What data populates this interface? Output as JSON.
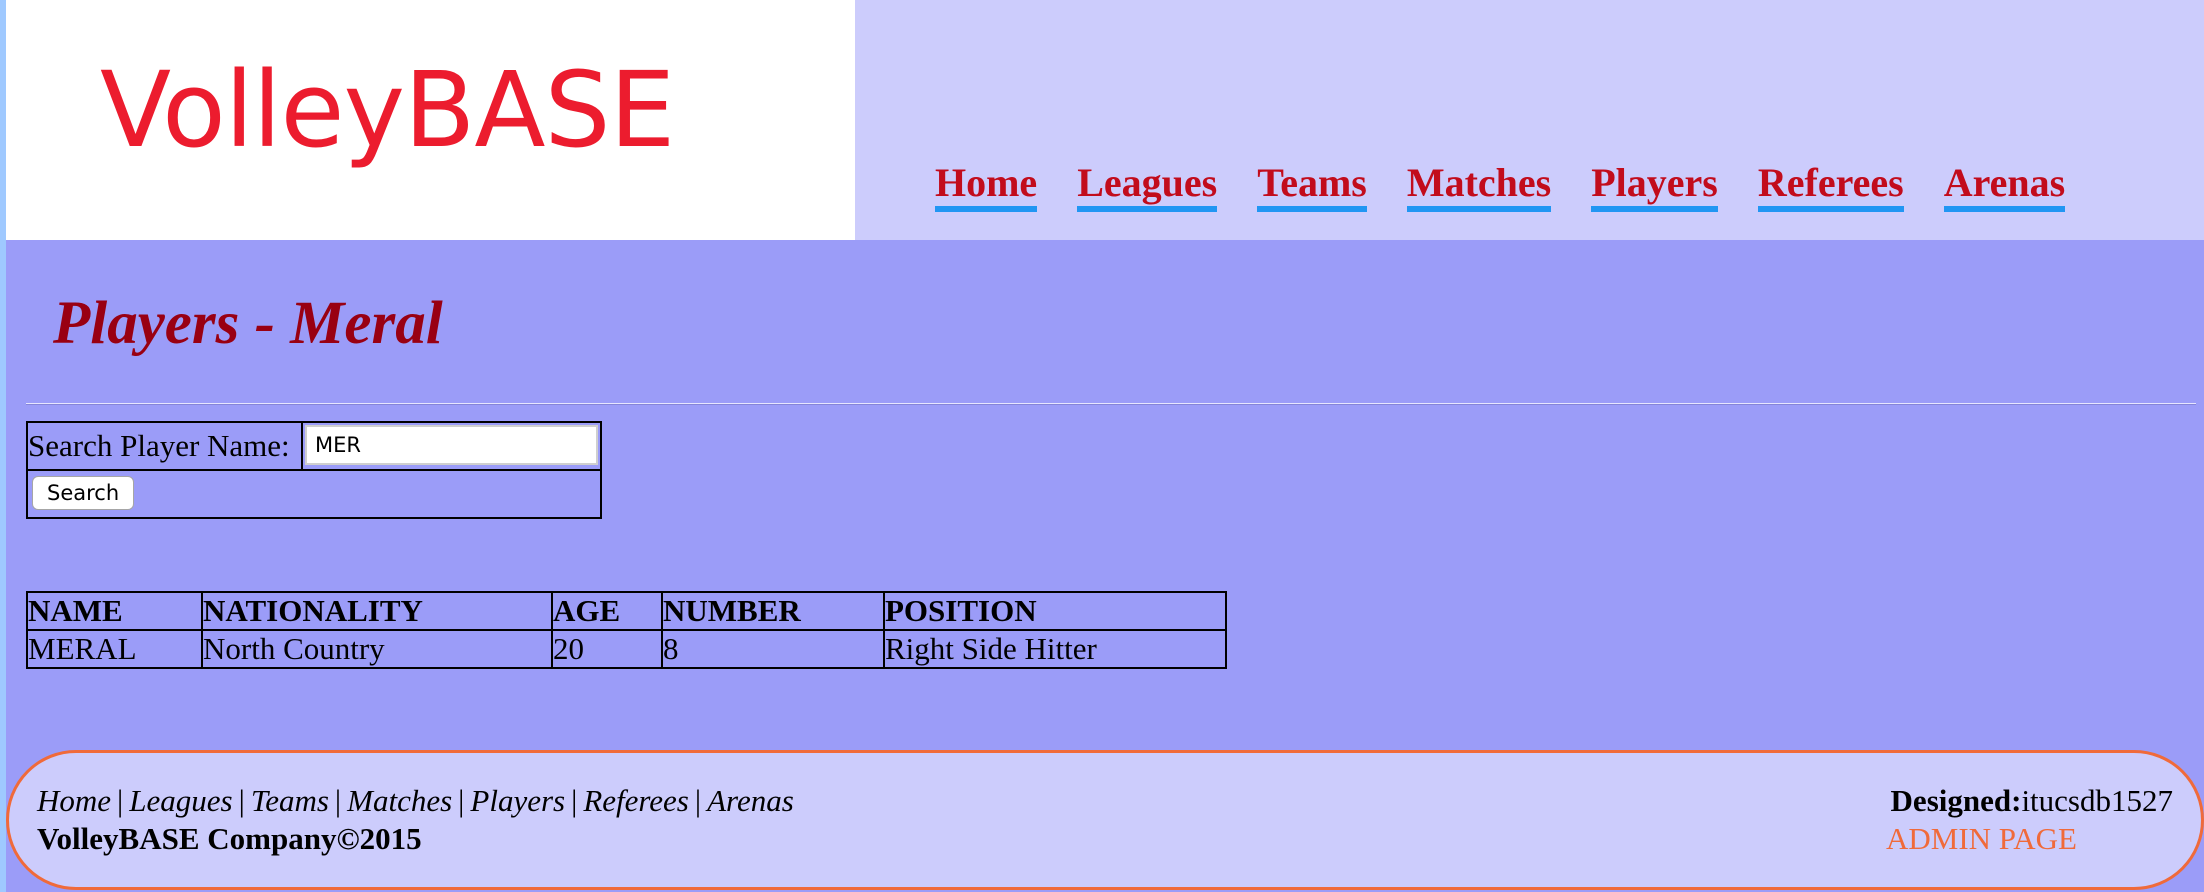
{
  "brand": {
    "logo_text": "VolleyBASE"
  },
  "nav": {
    "items": [
      {
        "label": "Home"
      },
      {
        "label": "Leagues"
      },
      {
        "label": "Teams"
      },
      {
        "label": "Matches"
      },
      {
        "label": "Players"
      },
      {
        "label": "Referees"
      },
      {
        "label": "Arenas"
      }
    ]
  },
  "page": {
    "title": "Players - Meral"
  },
  "search": {
    "label": "Search Player Name:",
    "value": "MER",
    "button_label": "Search"
  },
  "table": {
    "headers": [
      "NAME",
      "NATIONALITY",
      "AGE",
      "NUMBER",
      "POSITION"
    ],
    "rows": [
      [
        "MERAL",
        "North Country",
        "20",
        "8",
        "Right Side Hitter"
      ]
    ]
  },
  "footer": {
    "links": [
      "Home",
      "Leagues",
      "Teams",
      "Matches",
      "Players",
      "Referees",
      "Arenas"
    ],
    "separator": "|",
    "company": "VolleyBASE Company©2015",
    "designed_label": "Designed:",
    "designed_value": "itucsdb1527",
    "admin_label": "ADMIN PAGE"
  },
  "colors": {
    "background": "#9b9cf8",
    "header": "#ccccfc",
    "brand_red": "#ec1c2e",
    "nav_red": "#c20c1c",
    "nav_underline": "#2196f3",
    "title_red": "#990012",
    "footer_border": "#f06a3a"
  }
}
